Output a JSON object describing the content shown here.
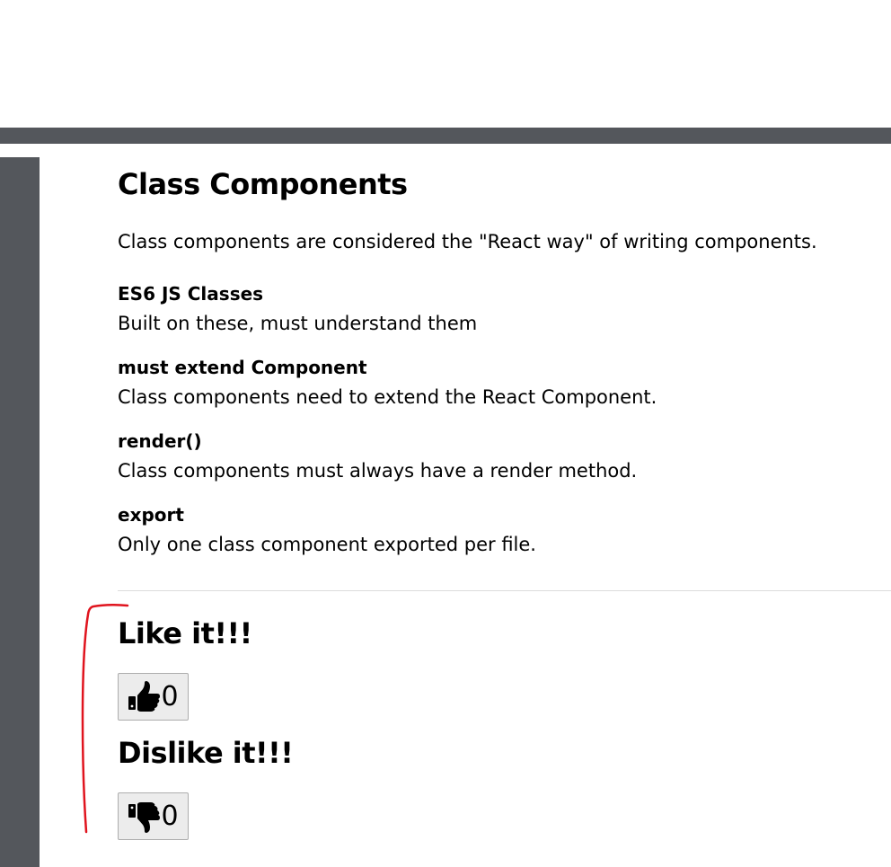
{
  "article": {
    "title": "Class Components",
    "intro": "Class components are considered the \"React way\" of writing components.",
    "items": [
      {
        "term": "ES6 JS Classes",
        "desc": "Built on these, must understand them"
      },
      {
        "term": "must extend Component",
        "desc": "Class components need to extend the React Component."
      },
      {
        "term": "render()",
        "desc": "Class components must always have a render method."
      },
      {
        "term": "export",
        "desc": "Only one class component exported per file."
      }
    ]
  },
  "votes": {
    "like_heading": "Like it!!!",
    "like_count": "0",
    "dislike_heading": "Dislike it!!!",
    "dislike_count": "0"
  },
  "icons": {
    "like": "thumbs-up-icon",
    "dislike": "thumbs-down-icon"
  },
  "colors": {
    "chrome_gray": "#54575c",
    "annotation_red": "#e0141e",
    "button_bg": "#ececec"
  }
}
